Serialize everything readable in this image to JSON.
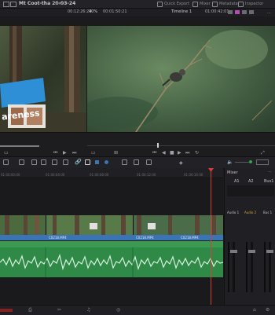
{
  "app": {
    "project_title": "Mt Coot-tha 20-03-24",
    "edited_label": "Edited"
  },
  "top_buttons": {
    "quick_export": "Quick Export",
    "mixer": "Mixer",
    "metadata": "Metadata",
    "inspector": "Inspector"
  },
  "viewer_header": {
    "source_timecode": "00:12:26:23",
    "zoom": "40%",
    "duration": "00:01:50:21",
    "timeline_name": "Timeline 1",
    "timeline_timecode": "01:00:42:01"
  },
  "source_sign_text": "areness",
  "timeline": {
    "ruler_ticks": [
      "01:00:00:00",
      "01:00:04:00",
      "01:00:08:00",
      "01:00:12:00",
      "01:00:16:00"
    ],
    "clip_names": [
      "C0218.MP4",
      "C0218.MP4",
      "C0218.MP4"
    ]
  },
  "mixer": {
    "title": "Mixer",
    "channels": [
      "A1",
      "A2",
      "Bus1"
    ],
    "strip_labels": [
      "Audio 1",
      "Audio 2",
      "Bus 1"
    ],
    "colors": {
      "audio2_label": "#d6a23a"
    }
  },
  "colors": {
    "accent_blue": "#3b74b4",
    "audio_green": "#3a9a52",
    "playhead_red": "#d83c3c"
  }
}
